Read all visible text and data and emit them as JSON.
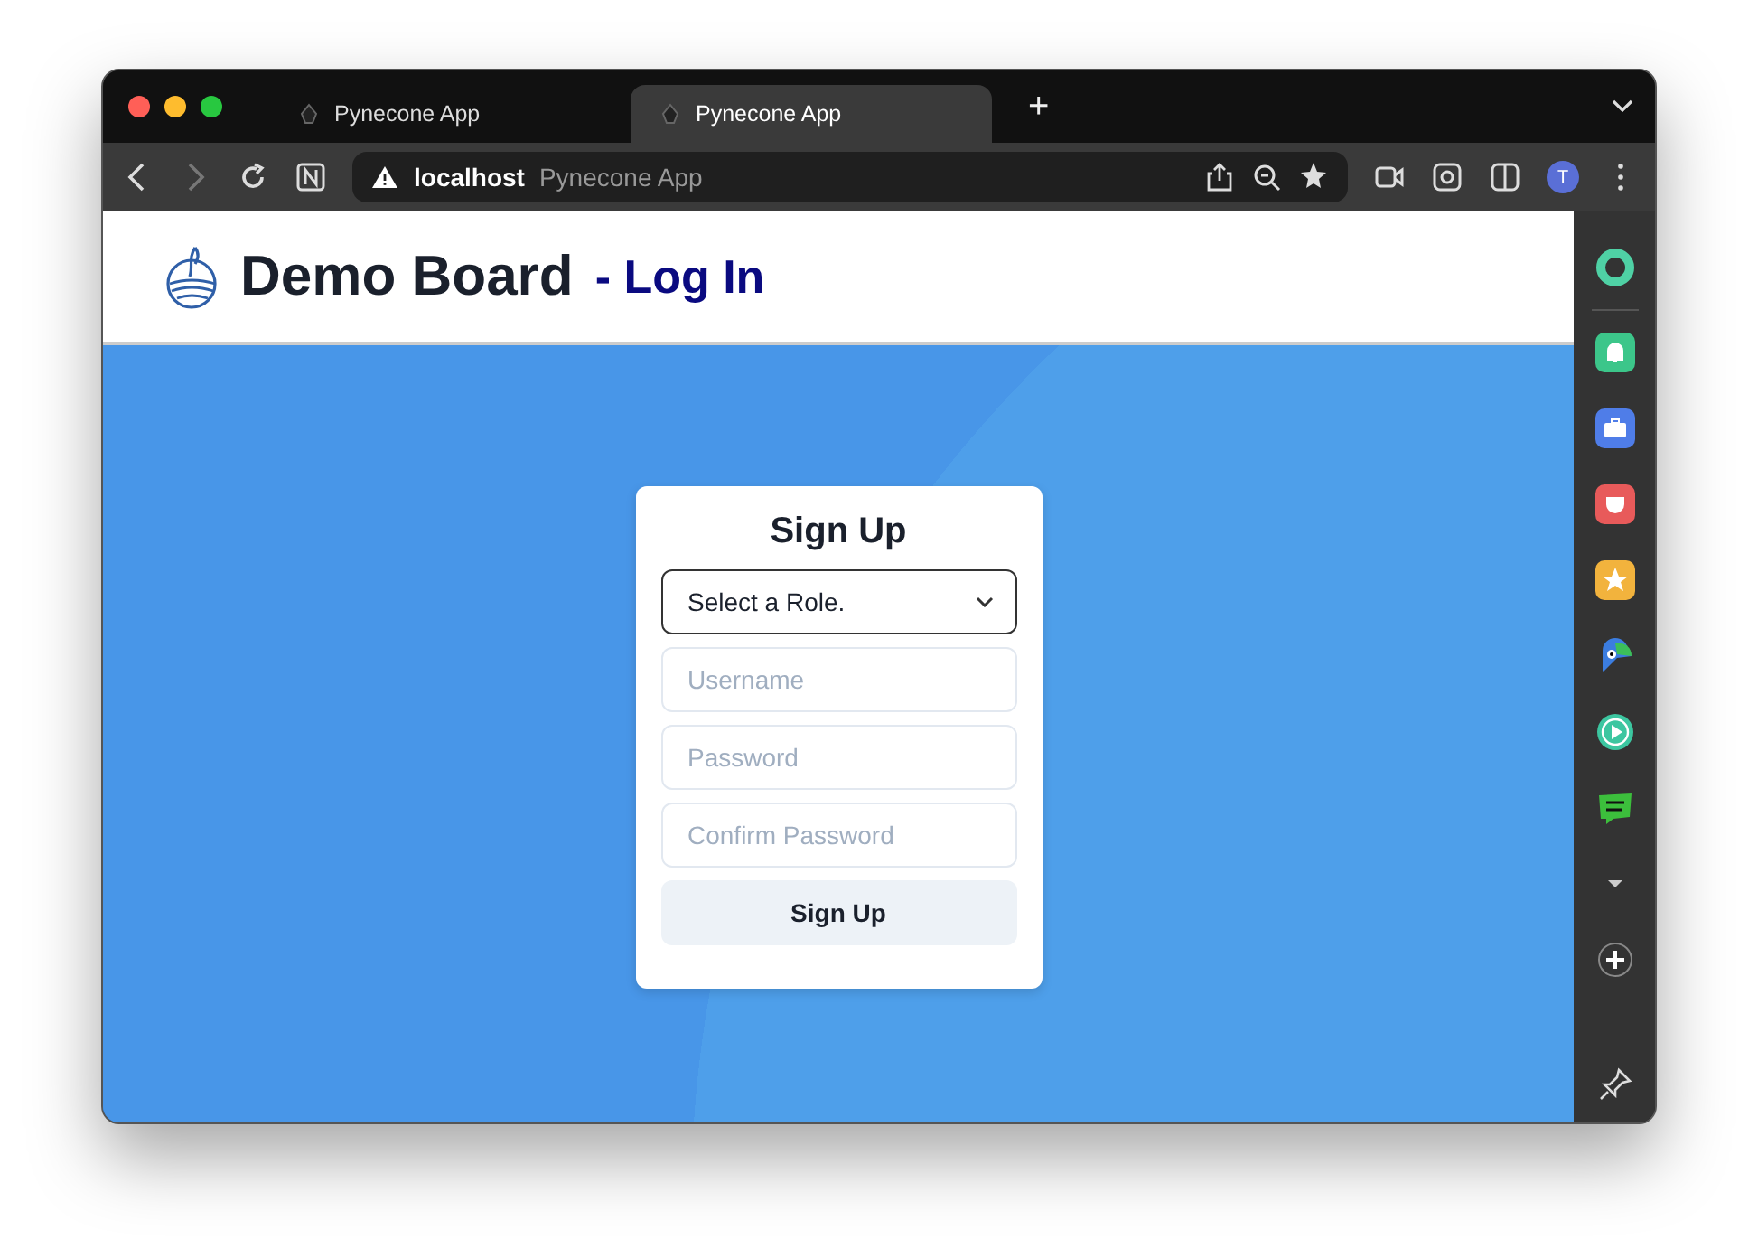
{
  "browser": {
    "tabs": [
      {
        "label": "Pynecone App",
        "selected": false
      },
      {
        "label": "Pynecone App",
        "selected": true
      }
    ],
    "new_tab": "+",
    "address": {
      "host": "localhost",
      "title": "Pynecone App"
    },
    "avatar": "T"
  },
  "header": {
    "title": "Demo Board",
    "subtitle": "- Log In"
  },
  "form": {
    "title": "Sign Up",
    "role_select": {
      "value": "Select a Role."
    },
    "fields": [
      {
        "placeholder": "Username"
      },
      {
        "placeholder": "Password"
      },
      {
        "placeholder": "Confirm Password"
      }
    ],
    "button": "Sign Up"
  }
}
